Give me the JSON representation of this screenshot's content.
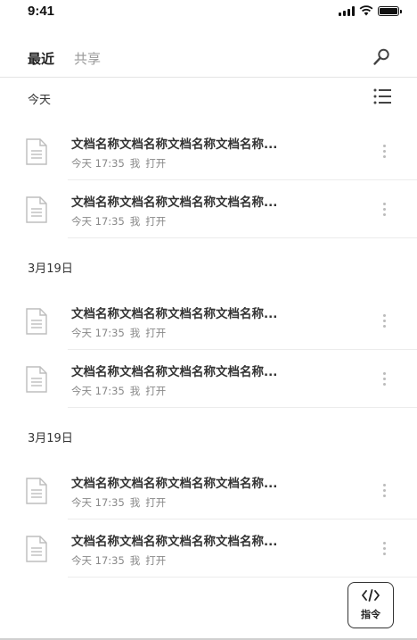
{
  "status_bar": {
    "time": "9:41"
  },
  "tabs": {
    "recent": "最近",
    "shared": "共享"
  },
  "sections": [
    {
      "title": "今天",
      "files": [
        {
          "name": "文档名称文档名称文档名称文档名称...",
          "time": "今天 17:35",
          "owner": "我",
          "action": "打开"
        },
        {
          "name": "文档名称文档名称文档名称文档名称...",
          "time": "今天 17:35",
          "owner": "我",
          "action": "打开"
        }
      ]
    },
    {
      "title": "3月19日",
      "files": [
        {
          "name": "文档名称文档名称文档名称文档名称...",
          "time": "今天 17:35",
          "owner": "我",
          "action": "打开"
        },
        {
          "name": "文档名称文档名称文档名称文档名称...",
          "time": "今天 17:35",
          "owner": "我",
          "action": "打开"
        }
      ]
    },
    {
      "title": "3月19日",
      "files": [
        {
          "name": "文档名称文档名称文档名称文档名称...",
          "time": "今天 17:35",
          "owner": "我",
          "action": "打开"
        },
        {
          "name": "文档名称文档名称文档名称文档名称...",
          "time": "今天 17:35",
          "owner": "我",
          "action": "打开"
        }
      ]
    }
  ],
  "command_button": {
    "label": "指令",
    "icon": "code-icon"
  },
  "icons": {
    "search": "search-icon",
    "list": "list-view-icon",
    "file": "document-icon",
    "more": "more-vertical-icon"
  },
  "colors": {
    "text_primary": "#333333",
    "text_secondary": "#888888",
    "divider": "#ececec"
  }
}
